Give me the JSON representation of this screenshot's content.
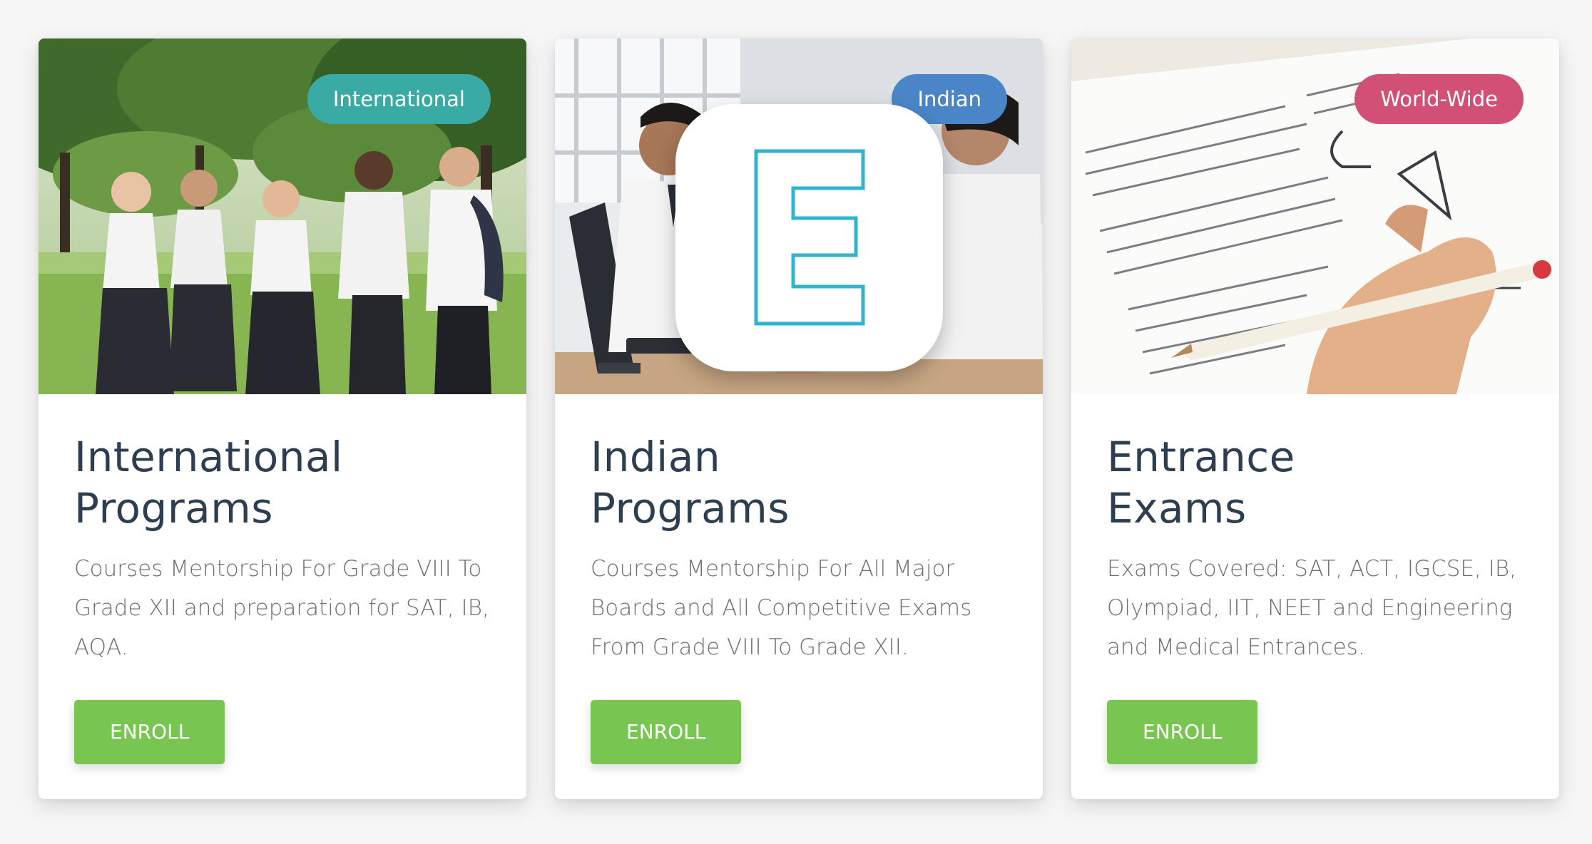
{
  "colors": {
    "teal": "#3aaba4",
    "blue": "#4a86c7",
    "pink": "#d24f76",
    "enroll": "#79c552",
    "title": "#2c3e50"
  },
  "cards": [
    {
      "badge": "International",
      "title_line1": "International",
      "title_line2": "Programs",
      "description": "Courses Mentorship For Grade VIII To Grade XII and preparation for SAT, IB, AQA.",
      "button": "ENROLL",
      "image": "students-outdoors-photo"
    },
    {
      "badge": "Indian",
      "title_line1": "Indian",
      "title_line2": "Programs",
      "description": "Courses Mentorship For All Major Boards and All Competitive Exams From Grade VIII To Grade XII.",
      "button": "ENROLL",
      "image": "classroom-photo",
      "overlay_icon": "e-app-icon"
    },
    {
      "badge": "World-Wide",
      "title_line1": "Entrance",
      "title_line2": "Exams",
      "description": "Exams Covered: SAT, ACT, IGCSE, IB, Olympiad, IIT, NEET and Engineering and Medical Entrances.",
      "button": "ENROLL",
      "image": "exam-paper-photo"
    }
  ]
}
